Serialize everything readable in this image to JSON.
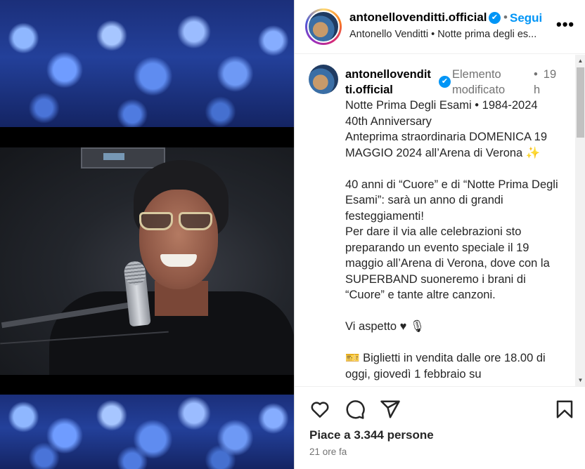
{
  "header": {
    "username": "antonellovenditti.official",
    "separator": "•",
    "follow_label": "Segui",
    "subtitle": "Antonello Venditti • Notte prima degli es...",
    "more_icon": "more-horizontal-icon"
  },
  "post": {
    "author_username": "antonellovendit ti.official",
    "edited_label": "Elemento modificato",
    "separator": "•",
    "time_label": "19 h",
    "caption": "Notte Prima Degli Esami • 1984-2024\n40th Anniversary\nAnteprima straordinaria DOMENICA 19 MAGGIO 2024 all’Arena di Verona ✨\n\n40 anni di “Cuore” e di “Notte Prima Degli Esami”: sarà un anno di grandi festeggiamenti!\nPer dare il via alle celebrazioni sto preparando un evento speciale il 19 maggio all’Arena di Verona, dove con la SUPERBAND suoneremo i brani di “Cuore” e tante altre canzoni.\n\nVi aspetto ♥ 🎙\n\n🎫 Biglietti in vendita dalle ore 18.00 di oggi, giovedì 1 febbraio su"
  },
  "actions": {
    "icons": [
      "heart-icon",
      "comment-icon",
      "share-icon",
      "bookmark-icon"
    ],
    "likes_text": "Piace a 3.344 persone",
    "posted_time": "21 ore fa"
  },
  "colors": {
    "accent": "#0095f6",
    "secondary_text": "#737373",
    "border": "#dbdbdb"
  }
}
